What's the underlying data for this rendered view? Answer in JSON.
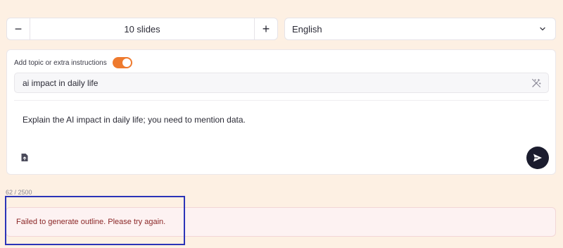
{
  "slides": {
    "minus_label": "−",
    "value": "10 slides",
    "plus_label": "+"
  },
  "language": {
    "selected": "English",
    "icon": "chevron-down-icon"
  },
  "topic_toggle": {
    "label": "Add topic or extra instructions",
    "on": true,
    "color": "#ee7a2e"
  },
  "topic_input": {
    "value": "ai impact in daily life",
    "icon": "magic-wand-icon"
  },
  "prompt": {
    "text": "Explain the AI impact in daily life; you need to mention data."
  },
  "char_count": "62 / 2500",
  "error": {
    "message": "Failed to generate outline. Please try again.",
    "color": "#8b2727"
  },
  "colors": {
    "background": "#fdf0e3",
    "send_button": "#1b1c2e",
    "highlight": "#2b34b8"
  }
}
